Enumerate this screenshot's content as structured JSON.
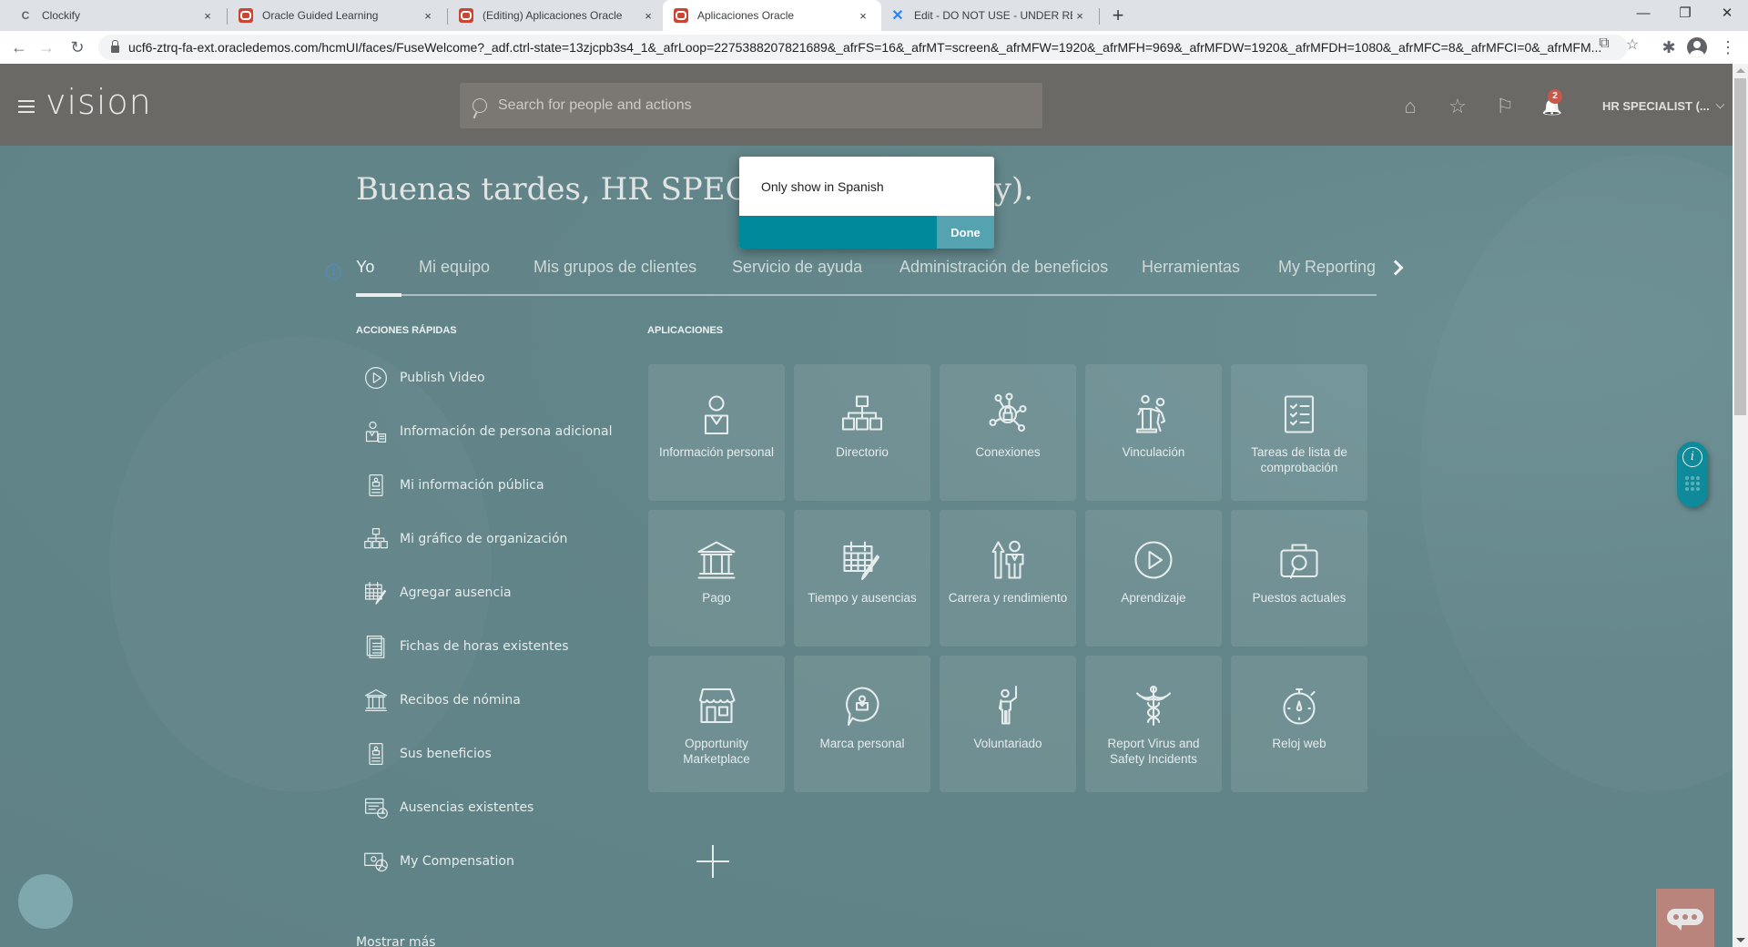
{
  "browser": {
    "tabs": [
      {
        "title": "Clockify",
        "icon": "clockify-icon",
        "active": false
      },
      {
        "title": "Oracle Guided Learning",
        "icon": "oracle-icon",
        "active": false
      },
      {
        "title": "(Editing) Aplicaciones Oracle",
        "icon": "oracle-icon",
        "active": false
      },
      {
        "title": "Aplicaciones Oracle",
        "icon": "oracle-icon",
        "active": true
      },
      {
        "title": "Edit - DO NOT USE - UNDER REV",
        "icon": "confluence-icon",
        "active": false
      }
    ],
    "close_glyph": "×",
    "new_tab_glyph": "+",
    "window_controls": {
      "minimize": "—",
      "restore": "❐",
      "close": "✕"
    },
    "nav": {
      "back": "←",
      "forward": "→",
      "reload": "↻"
    },
    "url": "ucf6-ztrq-fa-ext.oracledemos.com/hcmUI/faces/FuseWelcome?_adf.ctrl-state=13zjcpb3s4_1&_afrLoop=2275388207821689&_afrFS=16&_afrMT=screen&_afrMFW=1920&_afrMFH=969&_afrMFDW=1920&_afrMFDH=1080&_afrMFC=8&_afrMFCI=0&_afrMFM...",
    "toolbar_icons": {
      "translate": "⧉",
      "bookmark": "☆",
      "extensions": "✱",
      "menu": "⋮"
    }
  },
  "header": {
    "logo": "vision",
    "search_placeholder": "Search for people and actions",
    "icons": {
      "home": "⌂",
      "favorites": "☆",
      "watchlist": "⚐",
      "notifications": "🔔"
    },
    "notification_count": "2",
    "user_label": "HR SPECIALIST (..."
  },
  "greeting": "Buenas tardes, HR SPECIALIST (Security).",
  "popup": {
    "message": "Only show in Spanish",
    "done_label": "Done"
  },
  "nav_tabs": [
    {
      "label": "Yo",
      "active": true
    },
    {
      "label": "Mi equipo",
      "active": false
    },
    {
      "label": "Mis grupos de clientes",
      "active": false
    },
    {
      "label": "Servicio de ayuda",
      "active": false
    },
    {
      "label": "Administración de beneficios",
      "active": false
    },
    {
      "label": "Herramientas",
      "active": false
    },
    {
      "label": "My Reporting",
      "active": false
    }
  ],
  "info_glyph": "i",
  "quick_actions": {
    "title": "ACCIONES RÁPIDAS",
    "items": [
      {
        "label": "Publish Video",
        "icon": "play-circle-icon"
      },
      {
        "label": "Información de persona adicional",
        "icon": "person-document-icon"
      },
      {
        "label": "Mi información pública",
        "icon": "id-badge-icon"
      },
      {
        "label": "Mi gráfico de organización",
        "icon": "org-chart-icon"
      },
      {
        "label": "Agregar ausencia",
        "icon": "calendar-edit-icon"
      },
      {
        "label": "Fichas de horas existentes",
        "icon": "timecard-icon"
      },
      {
        "label": "Recibos de nómina",
        "icon": "bank-icon"
      },
      {
        "label": "Sus beneficios",
        "icon": "id-badge-icon"
      },
      {
        "label": "Ausencias existentes",
        "icon": "calendar-clock-icon"
      },
      {
        "label": "My Compensation",
        "icon": "money-chart-icon"
      }
    ],
    "show_more": "Mostrar más"
  },
  "apps": {
    "title": "APLICACIONES",
    "tiles": [
      {
        "label": "Información personal",
        "icon": "person-icon"
      },
      {
        "label": "Directorio",
        "icon": "org-chart-icon"
      },
      {
        "label": "Conexiones",
        "icon": "network-icon"
      },
      {
        "label": "Vinculación",
        "icon": "onboarding-icon"
      },
      {
        "label": "Tareas de lista de comprobación",
        "icon": "checklist-icon"
      },
      {
        "label": "Pago",
        "icon": "bank-icon"
      },
      {
        "label": "Tiempo y ausencias",
        "icon": "calendar-edit-icon"
      },
      {
        "label": "Carrera y rendimiento",
        "icon": "career-icon"
      },
      {
        "label": "Aprendizaje",
        "icon": "play-circle-icon"
      },
      {
        "label": "Puestos actuales",
        "icon": "briefcase-search-icon"
      },
      {
        "label": "Opportunity Marketplace",
        "icon": "store-icon"
      },
      {
        "label": "Marca personal",
        "icon": "personal-brand-icon"
      },
      {
        "label": "Voluntariado",
        "icon": "volunteer-icon"
      },
      {
        "label": "Report Virus and Safety Incidents",
        "icon": "caduceus-icon"
      },
      {
        "label": "Reloj web",
        "icon": "stopwatch-icon"
      }
    ]
  },
  "colors": {
    "header_bg": "#6b6966",
    "page_bg": "#628589",
    "popup_accent": "#00899b",
    "done_bg": "#55a3b0",
    "badge": "#c8584b",
    "guided_widget": "#0f8a9a",
    "chat_button": "#b8847c"
  }
}
